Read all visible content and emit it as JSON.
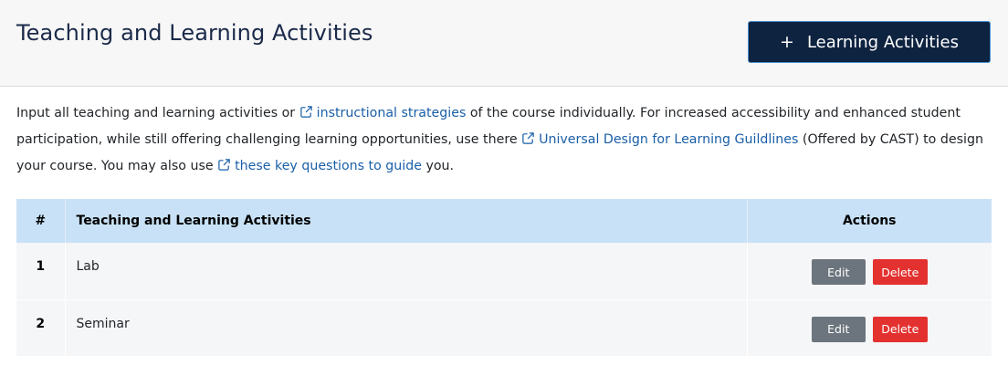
{
  "header": {
    "title": "Teaching and Learning Activities",
    "add_button_icon": "plus-icon",
    "add_button_label": "Learning Activities"
  },
  "intro": {
    "part1": "Input all teaching and learning activities or ",
    "link1": "instructional strategies",
    "part2": " of the course individually. For increased accessibility and enhanced student participation, while still offering challenging learning opportunities, use there ",
    "link2": "Universal Design for Learning Guildlines",
    "part3": " (Offered by CAST) to design your course. You may also use ",
    "link3": "these key questions to guide",
    "part4": " you.",
    "link_icon": "external-link-icon",
    "link_color": "#1a5fa8"
  },
  "table": {
    "headers": {
      "num": "#",
      "activity": "Teaching and Learning Activities",
      "actions": "Actions"
    },
    "rows": [
      {
        "num": "1",
        "activity": "Lab",
        "edit_label": "Edit",
        "delete_label": "Delete"
      },
      {
        "num": "2",
        "activity": "Seminar",
        "edit_label": "Edit",
        "delete_label": "Delete"
      }
    ]
  },
  "colors": {
    "primary_button": "#0e2340",
    "table_header": "#c8e1f6",
    "edit_button": "#6c757d",
    "delete_button": "#e3312f"
  }
}
